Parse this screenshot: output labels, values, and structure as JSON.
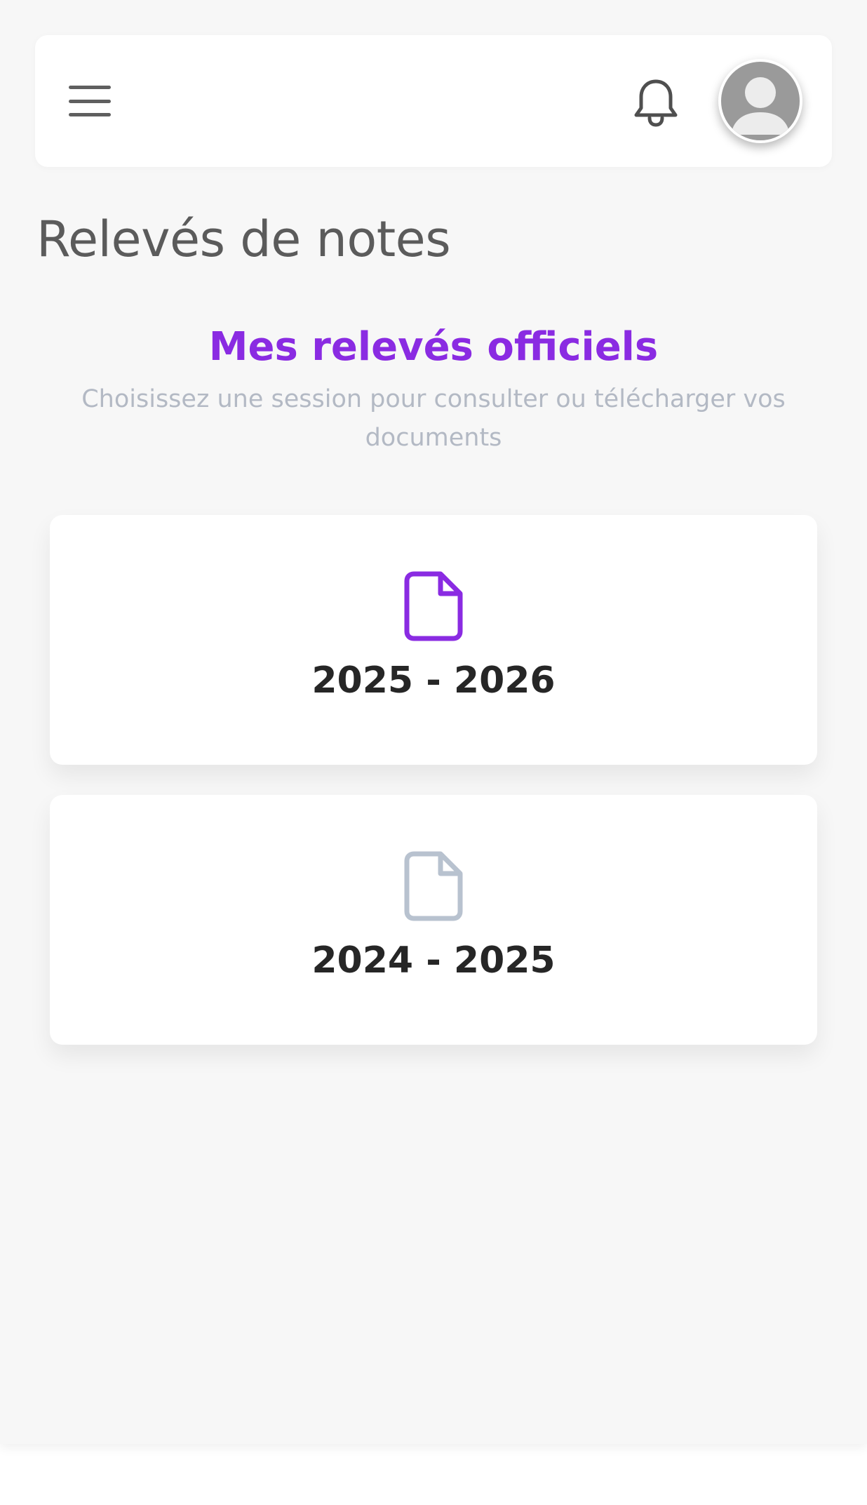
{
  "header": {
    "menu_icon": "hamburger-menu-icon",
    "bell_icon": "bell-icon",
    "avatar_icon": "user-avatar-icon"
  },
  "page": {
    "title": "Relevés de notes"
  },
  "section": {
    "title": "Mes relevés officiels",
    "subtitle": "Choisissez une session pour consulter ou télécharger vos documents"
  },
  "sessions": [
    {
      "label": "2025 - 2026",
      "icon": "document-icon",
      "icon_color": "#8a2be2",
      "active": true
    },
    {
      "label": "2024 - 2025",
      "icon": "document-icon",
      "icon_color": "#b8c2cf",
      "active": false
    }
  ],
  "colors": {
    "accent": "#8a2be2",
    "inactive_icon": "#b8c2cf",
    "background": "#f7f7f7",
    "title_text": "#5b5b5b",
    "card_text": "#262626",
    "subtitle_text": "#b3b9c4"
  }
}
